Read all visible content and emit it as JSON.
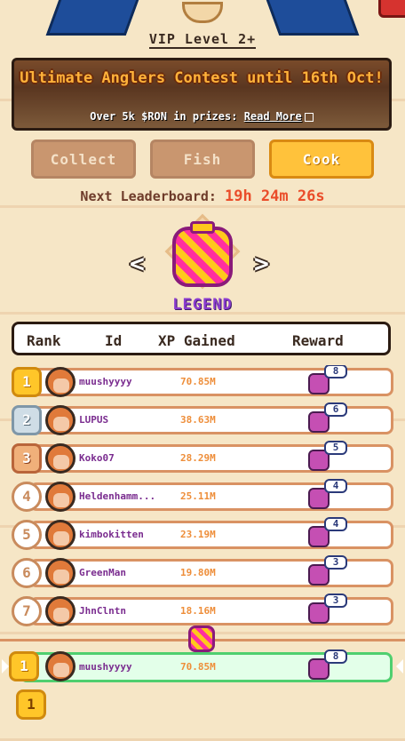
{
  "vip": {
    "label": "VIP Level 2+"
  },
  "promo": {
    "title": "Ultimate Anglers Contest until 16th Oct!",
    "subtitle": "Over 5k $RON in prizes:",
    "link": "Read More"
  },
  "tabs": [
    {
      "label": "Collect",
      "active": false
    },
    {
      "label": "Fish",
      "active": false
    },
    {
      "label": "Cook",
      "active": true
    }
  ],
  "leaderboard": {
    "next_label": "Next Leaderboard:",
    "countdown": "19h 24m 26s",
    "tier": "LEGEND",
    "prev_arrow": "<",
    "next_arrow": ">"
  },
  "columns": {
    "rank": "Rank",
    "id": "Id",
    "xp": "XP Gained",
    "reward": "Reward"
  },
  "rows": [
    {
      "rank": "1",
      "name": "muushyyyy",
      "xp": "70.85M",
      "reward": "8",
      "medal": "gold"
    },
    {
      "rank": "2",
      "name": "LUPUS",
      "xp": "38.63M",
      "reward": "6",
      "medal": "silver"
    },
    {
      "rank": "3",
      "name": "Koko07",
      "xp": "28.29M",
      "reward": "5",
      "medal": "bronze"
    },
    {
      "rank": "4",
      "name": "Heldenhamm...",
      "xp": "25.11M",
      "reward": "4",
      "medal": "none"
    },
    {
      "rank": "5",
      "name": "kimbokitten",
      "xp": "23.19M",
      "reward": "4",
      "medal": "none"
    },
    {
      "rank": "6",
      "name": "GreenMan",
      "xp": "19.80M",
      "reward": "3",
      "medal": "none"
    },
    {
      "rank": "7",
      "name": "JhnClntn",
      "xp": "18.16M",
      "reward": "3",
      "medal": "none"
    }
  ],
  "self_row": {
    "rank": "1",
    "name": "muushyyyy",
    "xp": "70.85M",
    "reward": "8"
  },
  "pager": {
    "page": "1"
  }
}
